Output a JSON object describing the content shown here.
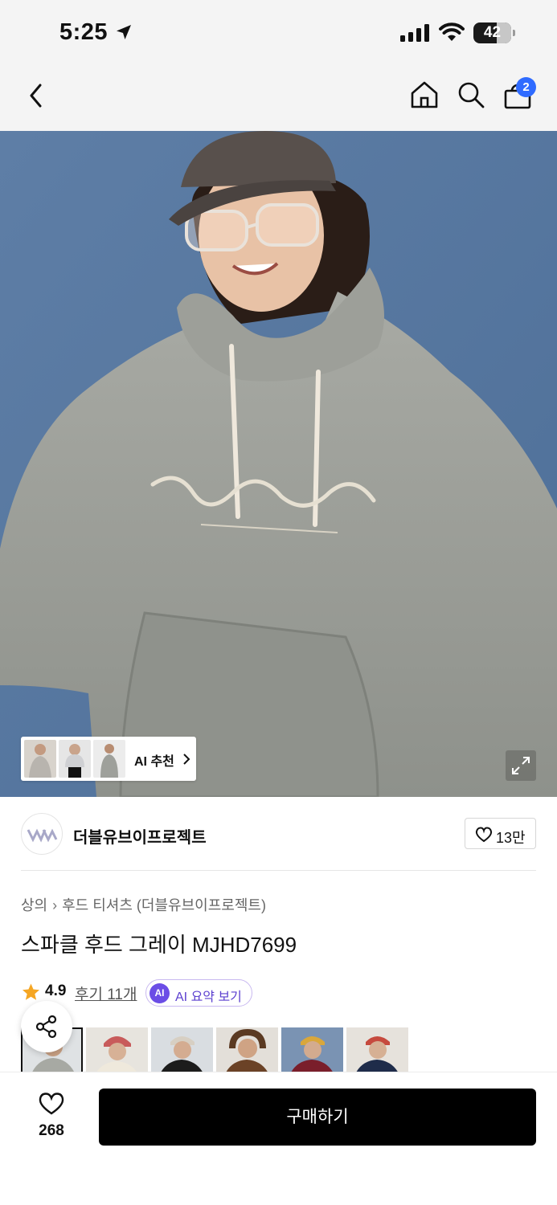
{
  "status_bar": {
    "time": "5:25",
    "battery": "42"
  },
  "nav": {
    "cart_count": "2"
  },
  "hero": {
    "ai_recommend_label": "AI 추천"
  },
  "brand": {
    "name": "더블유브이프로젝트",
    "like_count": "13만"
  },
  "breadcrumb": {
    "category": "상의",
    "subcategory": "후드 티셔츠 (더블유브이프로젝트)"
  },
  "product": {
    "title": "스파클 후드 그레이 MJHD7699"
  },
  "rating": {
    "score": "4.9",
    "review_link": "후기 11개",
    "ai_badge": "AI",
    "ai_summary_label": "AI 요약 보기"
  },
  "color_options": [
    "그레이",
    "아이보리",
    "블랙",
    "브라운",
    "버건디",
    "네이비"
  ],
  "bottom_bar": {
    "wish_count": "268",
    "buy_label": "구매하기"
  },
  "colors": {
    "accent_badge": "#2f6bff",
    "ai_purple": "#6b4de6",
    "star": "#f5a623",
    "buy_button": "#000000"
  }
}
